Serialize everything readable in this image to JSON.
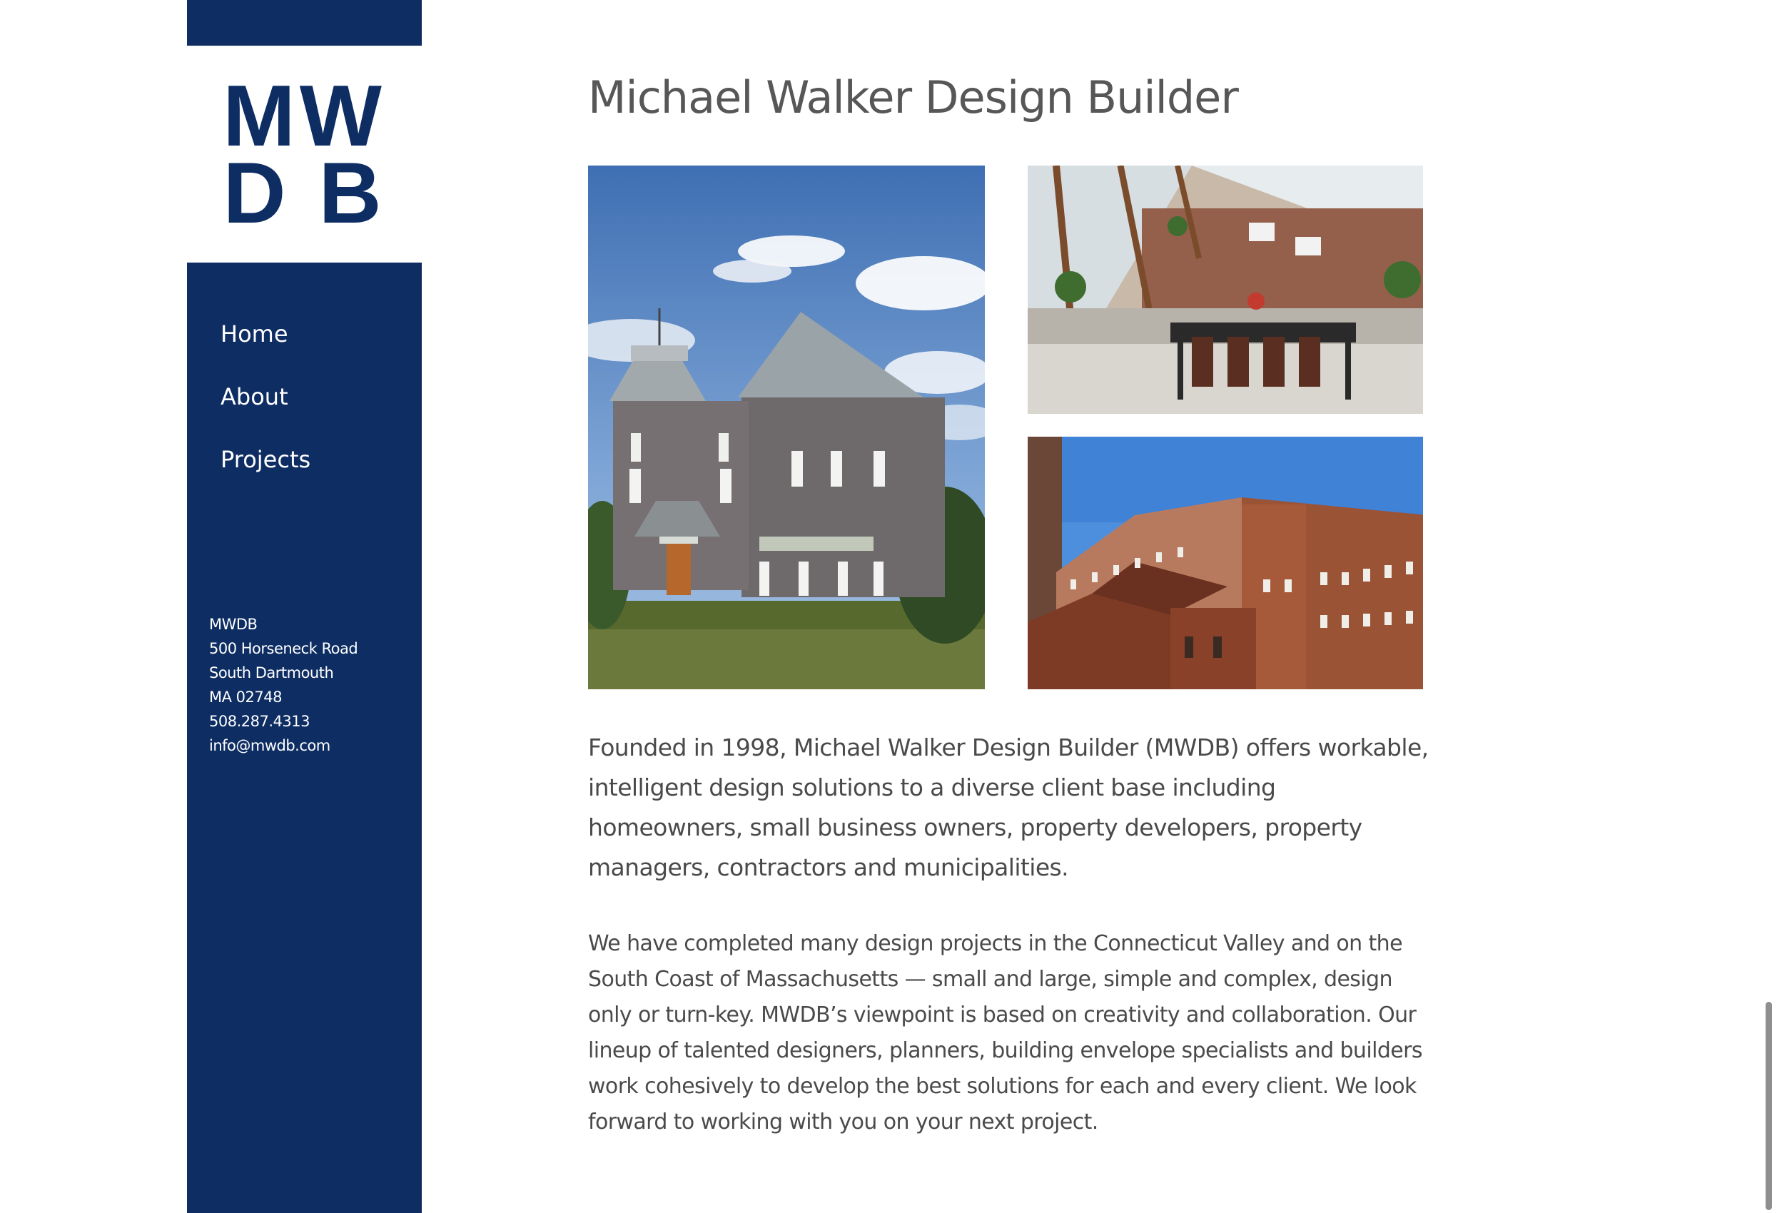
{
  "logo": {
    "line1": "MW",
    "line2": "D B"
  },
  "nav": {
    "items": [
      {
        "label": "Home"
      },
      {
        "label": "About"
      },
      {
        "label": "Projects"
      }
    ]
  },
  "contact": {
    "name": "MWDB",
    "street": "500 Horseneck Road",
    "city": "South Dartmouth",
    "state_zip": "MA 02748",
    "phone": "508.287.4313",
    "email": "info@mwdb.com"
  },
  "main": {
    "title": "Michael Walker Design Builder",
    "paragraph1": "Founded in 1998, Michael Walker Design Builder (MWDB) offers workable, intelligent design solutions to a diverse client base including homeowners, small business owners, property developers, property managers, contractors and municipalities.",
    "paragraph2": "We have completed many design projects in the Connecticut Valley and on the South Coast of Massachusetts — small and large, simple and complex, design only or turn-key. MWDB’s viewpoint is based on creativity and collaboration. Our lineup of talented designers, planners, building envelope specialists and builders work cohesively to develop the best solutions for each and every client. We look forward to working with you on your next project."
  },
  "colors": {
    "brand_navy": "#0d2d63",
    "text_gray": "#4a4a4a",
    "title_gray": "#575757"
  }
}
